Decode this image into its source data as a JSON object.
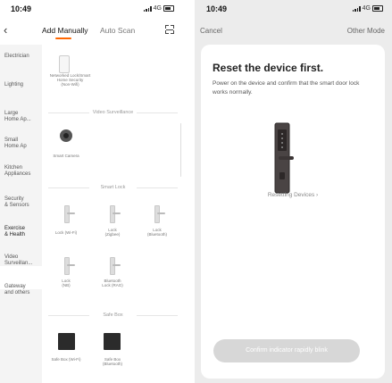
{
  "left_screen": {
    "time": "10:49",
    "network": "4G",
    "back_label": "‹",
    "tabs": [
      {
        "label": "Add Manually",
        "active": true
      },
      {
        "label": "Auto Scan",
        "active": false
      }
    ],
    "sidebar": [
      "Electrician",
      "Lighting",
      "Large\nHome Ap...",
      "Small\nHome Ap",
      "Kitchen\nAppliances",
      "Security\n& Sensors",
      "Exercise\n& Health",
      "Video\nSurveillan...",
      "Gateway\nand others"
    ],
    "sections": [
      {
        "title": "Video Surveillance",
        "devices": [
          "Smart Camera"
        ]
      },
      {
        "title": "Smart Lock",
        "devices": [
          "Lock (Wi-Fi)",
          "Lock\n(Zigbee)",
          "Lock\n(Bluetooth)",
          "Lock\n(NB)",
          "Bluetooth\nLock (RAG)"
        ]
      },
      {
        "title": "Safe Box",
        "devices": [
          "Safe Box (Wi-Fi)",
          "Safe Box\n(Bluetooth)"
        ]
      }
    ],
    "top_device": "Networked Lock/Smart\nHome Security\n(Non-Wifi)"
  },
  "right_screen": {
    "time": "10:49",
    "network": "4G",
    "cancel_label": "Cancel",
    "other_mode_label": "Other Mode",
    "title": "Reset the device first.",
    "description": "Power on the device and confirm that the smart door lock works normally.",
    "resetting_link": "Resetting Devices ›",
    "confirm_button": "Confirm indicator rapidly blink"
  },
  "colors": {
    "accent": "#ff6600",
    "button_disabled": "#d7d7d7",
    "background_gray": "#ececec"
  }
}
